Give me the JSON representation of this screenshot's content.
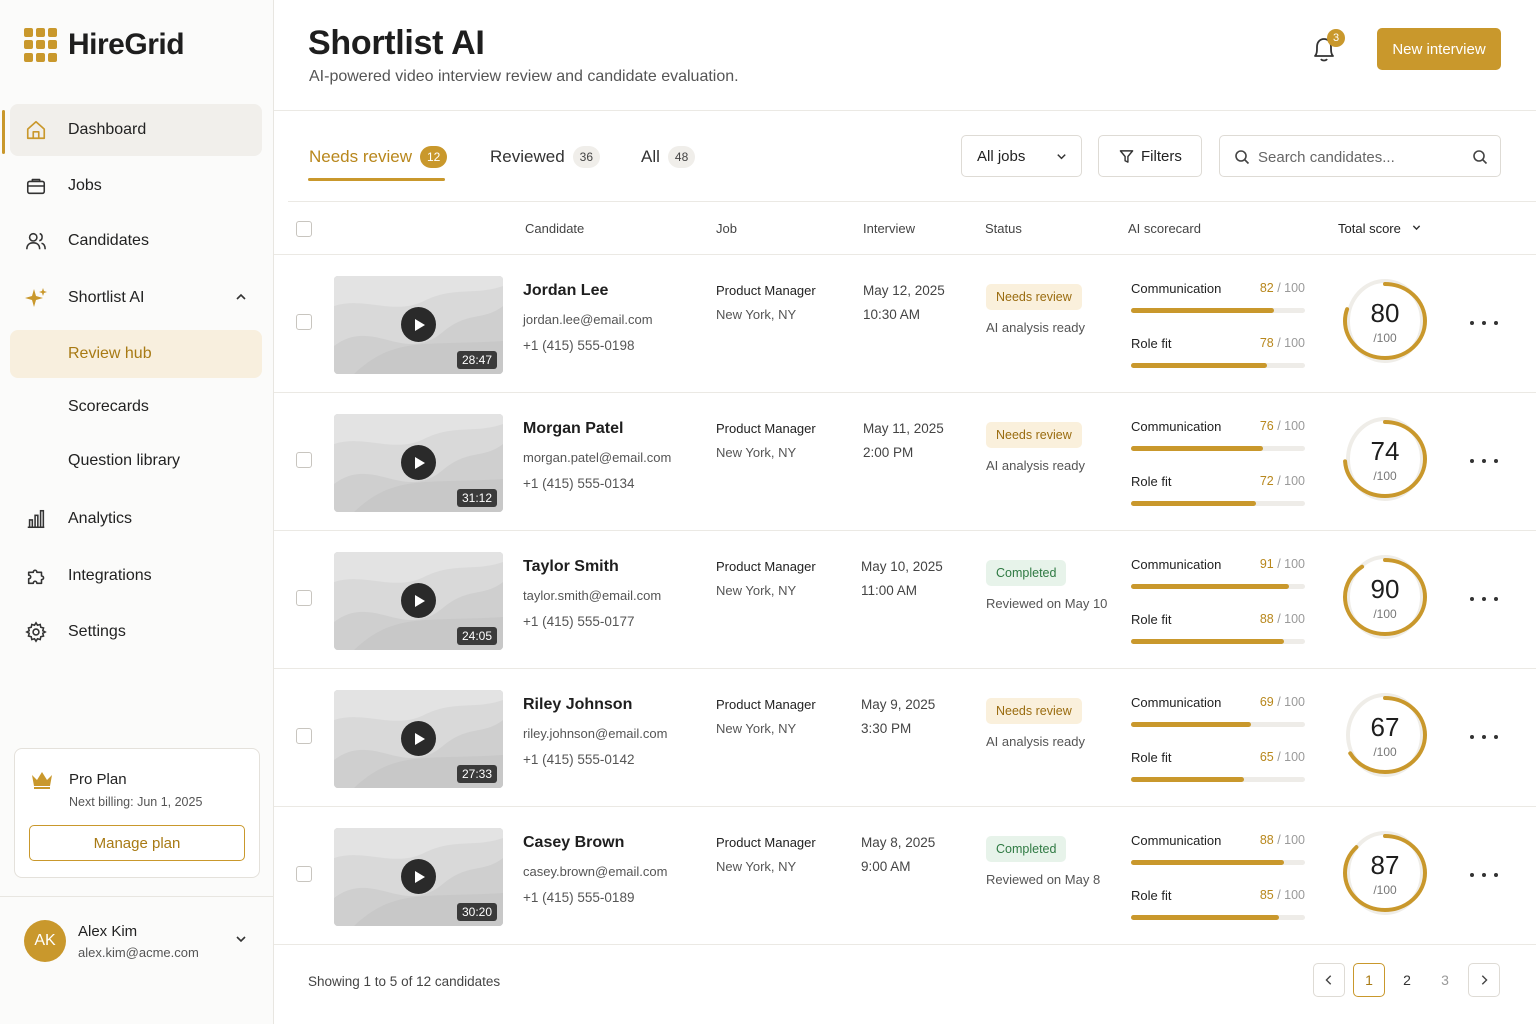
{
  "app": {
    "name": "HireGrid"
  },
  "sidebar": {
    "nav": [
      {
        "label": "Dashboard",
        "icon": "home-icon"
      },
      {
        "label": "Jobs",
        "icon": "briefcase-icon"
      },
      {
        "label": "Candidates",
        "icon": "users-icon"
      },
      {
        "label": "Shortlist AI",
        "icon": "sparkle-icon"
      },
      {
        "label": "Analytics",
        "icon": "bar-chart-icon"
      },
      {
        "label": "Integrations",
        "icon": "puzzle-icon"
      },
      {
        "label": "Settings",
        "icon": "gear-icon"
      }
    ],
    "sub": [
      "Review hub",
      "Scorecards",
      "Question library"
    ],
    "plan": {
      "name": "Pro Plan",
      "billing": "Next billing: Jun 1, 2025",
      "button": "Manage plan"
    },
    "user": {
      "initials": "AK",
      "name": "Alex Kim",
      "email": "alex.kim@acme.com"
    }
  },
  "header": {
    "title": "Shortlist AI",
    "subtitle": "AI-powered video interview review and candidate evaluation.",
    "notifications": "3",
    "new_button": "New interview"
  },
  "tabs": [
    {
      "label": "Needs review",
      "count": "12"
    },
    {
      "label": "Reviewed",
      "count": "36"
    },
    {
      "label": "All",
      "count": "48"
    }
  ],
  "toolbar": {
    "jobs_select": "All jobs",
    "filters": "Filters",
    "search_placeholder": "Search candidates..."
  },
  "columns": [
    "Candidate",
    "Job",
    "Interview",
    "Status",
    "AI scorecard",
    "Total score"
  ],
  "metric_labels": {
    "communication": "Communication",
    "role_fit": "Role fit",
    "out_of": "100",
    "total_out_of": "/100"
  },
  "candidates": [
    {
      "duration": "28:47",
      "name": "Jordan Lee",
      "email": "jordan.lee@email.com",
      "phone": "+1 (415) 555-0198",
      "job": "Product Manager",
      "location": "New York, NY",
      "date": "May 12, 2025",
      "time": "10:30 AM",
      "status": "Needs review",
      "status_type": "review",
      "note": "AI analysis ready",
      "communication": 82,
      "role_fit": 78,
      "total": 80
    },
    {
      "duration": "31:12",
      "name": "Morgan Patel",
      "email": "morgan.patel@email.com",
      "phone": "+1 (415) 555-0134",
      "job": "Product Manager",
      "location": "New York, NY",
      "date": "May 11, 2025",
      "time": "2:00 PM",
      "status": "Needs review",
      "status_type": "review",
      "note": "AI analysis ready",
      "communication": 76,
      "role_fit": 72,
      "total": 74
    },
    {
      "duration": "24:05",
      "name": "Taylor Smith",
      "email": "taylor.smith@email.com",
      "phone": "+1 (415) 555-0177",
      "job": "Product Manager",
      "location": "New York, NY",
      "date": "May 10, 2025",
      "time": "11:00 AM",
      "status": "Completed",
      "status_type": "done",
      "note": "Reviewed on May 10",
      "communication": 91,
      "role_fit": 88,
      "total": 90
    },
    {
      "duration": "27:33",
      "name": "Riley Johnson",
      "email": "riley.johnson@email.com",
      "phone": "+1 (415) 555-0142",
      "job": "Product Manager",
      "location": "New York, NY",
      "date": "May 9, 2025",
      "time": "3:30 PM",
      "status": "Needs review",
      "status_type": "review",
      "note": "AI analysis ready",
      "communication": 69,
      "role_fit": 65,
      "total": 67
    },
    {
      "duration": "30:20",
      "name": "Casey Brown",
      "email": "casey.brown@email.com",
      "phone": "+1 (415) 555-0189",
      "job": "Product Manager",
      "location": "New York, NY",
      "date": "May 8, 2025",
      "time": "9:00 AM",
      "status": "Completed",
      "status_type": "done",
      "note": "Reviewed on May 8",
      "communication": 88,
      "role_fit": 85,
      "total": 87
    }
  ],
  "footer": {
    "showing": "Showing 1 to 5 of 12 candidates",
    "pages": [
      "1",
      "2",
      "3"
    ]
  },
  "colors": {
    "accent": "#c9982c",
    "review_badge": "#faf0dc",
    "done_badge": "#e7f3ea"
  }
}
